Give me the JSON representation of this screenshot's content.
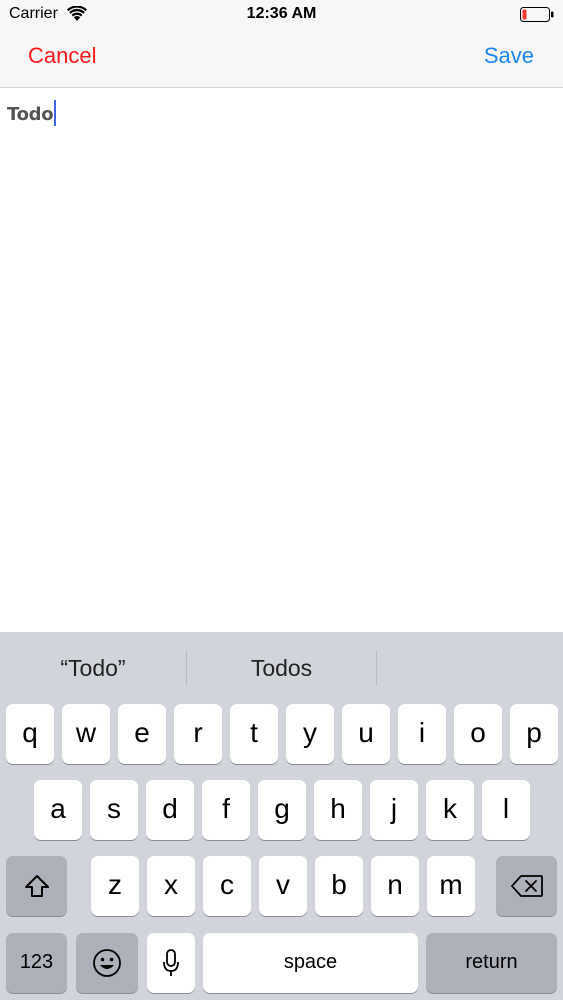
{
  "status_bar": {
    "carrier": "Carrier",
    "time": "12:36 AM"
  },
  "nav": {
    "cancel_label": "Cancel",
    "save_label": "Save",
    "cancel_color": "#ff1a1a",
    "save_color": "#1b86f2"
  },
  "editor": {
    "text": "Todo"
  },
  "keyboard": {
    "suggestions": [
      "“Todo”",
      "Todos",
      ""
    ],
    "row1": [
      "q",
      "w",
      "e",
      "r",
      "t",
      "y",
      "u",
      "i",
      "o",
      "p"
    ],
    "row2": [
      "a",
      "s",
      "d",
      "f",
      "g",
      "h",
      "j",
      "k",
      "l"
    ],
    "row3": [
      "z",
      "x",
      "c",
      "v",
      "b",
      "n",
      "m"
    ],
    "numbers_label": "123",
    "space_label": "space",
    "return_label": "return",
    "icons": {
      "shift": "shift-icon",
      "delete": "backspace-icon",
      "emoji": "emoji-icon",
      "mic": "microphone-icon"
    }
  }
}
